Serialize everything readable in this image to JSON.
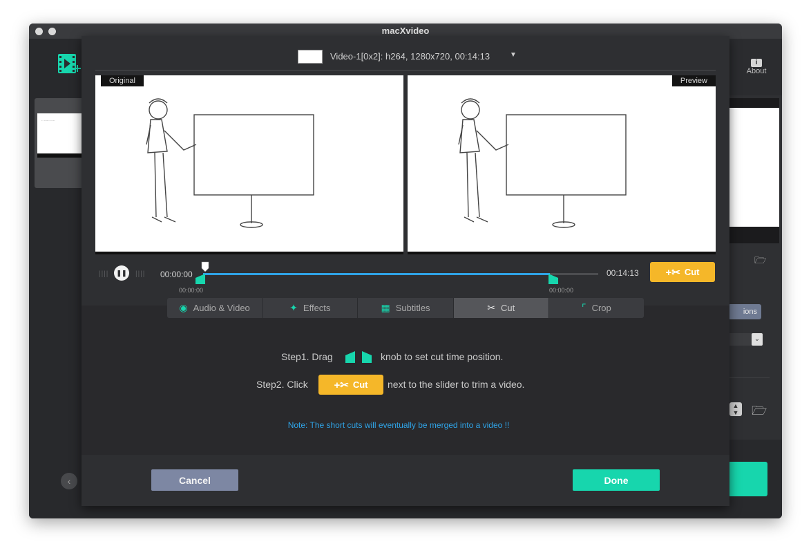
{
  "window": {
    "title": "macXvideo"
  },
  "toolbar": {
    "about_label": "About",
    "about_icon": "i"
  },
  "right_panel": {
    "options_label": "ions"
  },
  "video": {
    "info": "Video-1[0x2]: h264, 1280x720, 00:14:13"
  },
  "panels": {
    "original_label": "Original",
    "preview_label": "Preview"
  },
  "timeline": {
    "start_time": "00:00:00",
    "end_time": "00:14:13",
    "left_knob_time": "00:00:00",
    "right_knob_time": "00:00:00",
    "selection_start_fraction": 0.0,
    "selection_end_fraction": 0.88,
    "cut_label": "Cut"
  },
  "tabs": [
    {
      "label": "Audio & Video",
      "icon": "speaker-icon"
    },
    {
      "label": "Effects",
      "icon": "magic-wand-icon"
    },
    {
      "label": "Subtitles",
      "icon": "subtitles-icon"
    },
    {
      "label": "Cut",
      "icon": "scissors-icon",
      "active": true
    },
    {
      "label": "Crop",
      "icon": "crop-icon"
    }
  ],
  "instructions": {
    "step1_prefix": "Step1. Drag",
    "step1_suffix": "knob to set cut time position.",
    "step2_prefix": "Step2. Click",
    "step2_suffix": "next to the slider to trim a video.",
    "cut_label": "Cut",
    "note": "Note: The short cuts will eventually be merged into a video !!"
  },
  "footer": {
    "cancel_label": "Cancel",
    "done_label": "Done"
  },
  "colors": {
    "accent": "#17d6ad",
    "cut": "#f5b729",
    "note": "#2fa3e6",
    "cancel": "#7d87a3"
  }
}
